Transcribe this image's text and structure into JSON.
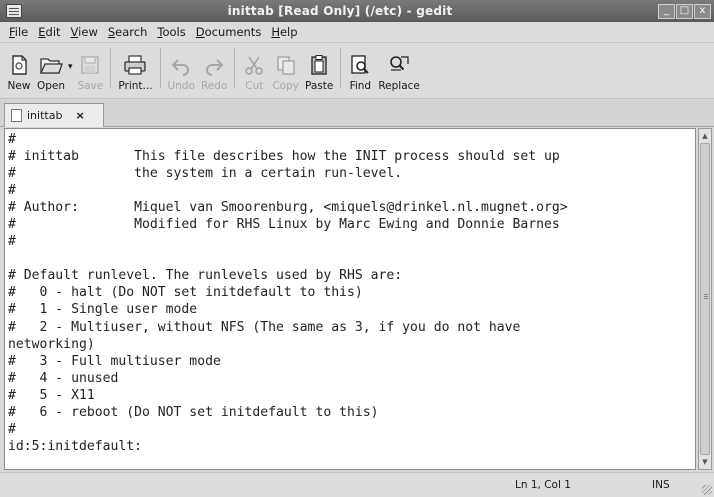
{
  "window": {
    "title": "inittab [Read Only] (/etc) - gedit",
    "buttons": [
      "_",
      "□",
      "x"
    ]
  },
  "menu": [
    {
      "mnemonic": "F",
      "rest": "ile"
    },
    {
      "mnemonic": "E",
      "rest": "dit"
    },
    {
      "mnemonic": "V",
      "rest": "iew"
    },
    {
      "mnemonic": "S",
      "rest": "earch"
    },
    {
      "mnemonic": "T",
      "rest": "ools"
    },
    {
      "mnemonic": "D",
      "rest": "ocuments"
    },
    {
      "mnemonic": "H",
      "rest": "elp"
    }
  ],
  "toolbar": {
    "new": "New",
    "open": "Open",
    "save": "Save",
    "print": "Print...",
    "undo": "Undo",
    "redo": "Redo",
    "cut": "Cut",
    "copy": "Copy",
    "paste": "Paste",
    "find": "Find",
    "replace": "Replace"
  },
  "tab": {
    "label": "inittab",
    "close": "×"
  },
  "editor": {
    "content": "#\n# inittab       This file describes how the INIT process should set up\n#               the system in a certain run-level.\n#\n# Author:       Miquel van Smoorenburg, <miquels@drinkel.nl.mugnet.org>\n#               Modified for RHS Linux by Marc Ewing and Donnie Barnes\n#\n\n# Default runlevel. The runlevels used by RHS are:\n#   0 - halt (Do NOT set initdefault to this)\n#   1 - Single user mode\n#   2 - Multiuser, without NFS (The same as 3, if you do not have\nnetworking)\n#   3 - Full multiuser mode\n#   4 - unused\n#   5 - X11\n#   6 - reboot (Do NOT set initdefault to this)\n#\nid:5:initdefault:"
  },
  "status": {
    "position": "Ln 1, Col 1",
    "mode": "INS"
  }
}
